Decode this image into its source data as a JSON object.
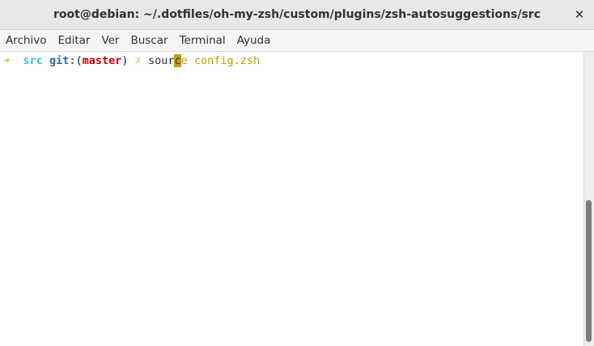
{
  "window": {
    "title": "root@debian: ~/.dotfiles/oh-my-zsh/custom/plugins/zsh-autosuggestions/src",
    "close_glyph": "✕"
  },
  "menu": {
    "items": [
      "Archivo",
      "Editar",
      "Ver",
      "Buscar",
      "Terminal",
      "Ayuda"
    ]
  },
  "terminal": {
    "prompt_arrow": "➜",
    "directory": "src",
    "git_prefix": "git:",
    "paren_open": "(",
    "branch": "master",
    "paren_close": ")",
    "dirty_mark": "✗",
    "typed_before_cursor": "sour",
    "cursor_char": "c",
    "suggestion": "e config.zsh"
  },
  "colors": {
    "arrow": "#8ae234",
    "directory": "#34c6c6",
    "git": "#3465a4",
    "branch": "#cc0000",
    "suggestion": "#c4a000",
    "cursor": "#c4a000"
  }
}
